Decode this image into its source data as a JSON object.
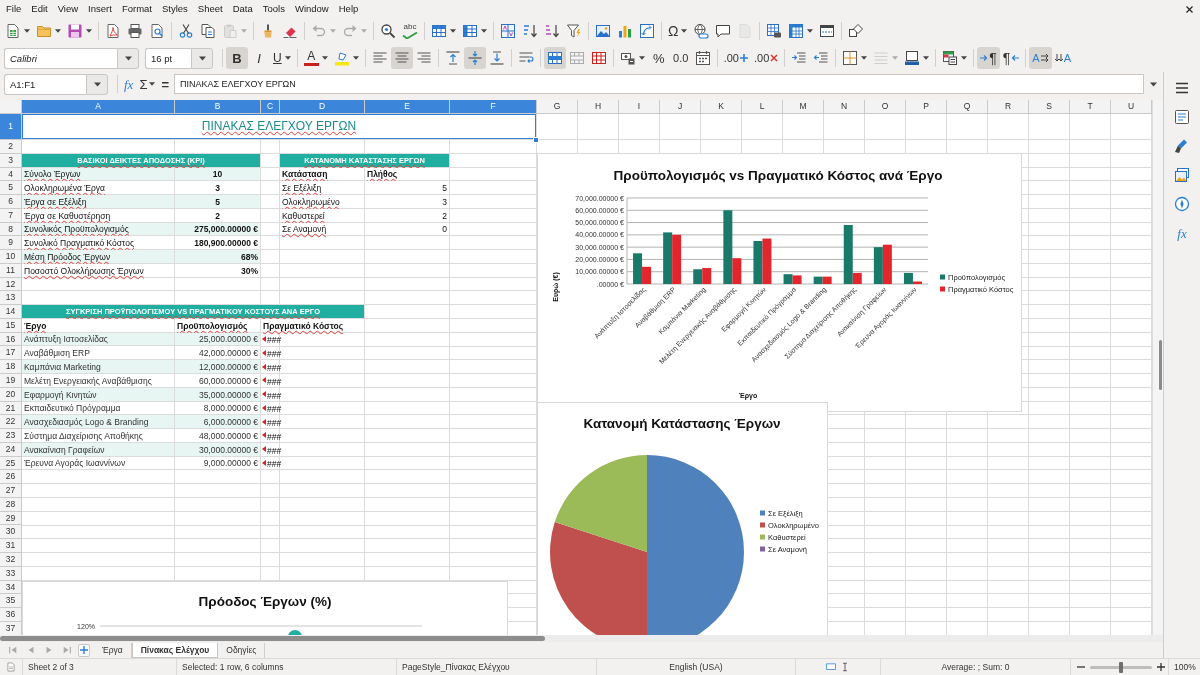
{
  "menu_bar": {
    "items": [
      "File",
      "Edit",
      "View",
      "Insert",
      "Format",
      "Styles",
      "Sheet",
      "Data",
      "Tools",
      "Window",
      "Help"
    ]
  },
  "standard_toolbar": {
    "groups": [
      [
        {
          "kind": "new",
          "dropdown": true,
          "disabled": false
        },
        {
          "kind": "open",
          "dropdown": true,
          "disabled": false
        },
        {
          "kind": "save",
          "dropdown": true,
          "disabled": false
        }
      ],
      [
        {
          "kind": "pdf",
          "dropdown": false,
          "disabled": false
        },
        {
          "kind": "print",
          "dropdown": false,
          "disabled": false
        },
        {
          "kind": "preview",
          "dropdown": false,
          "disabled": false
        }
      ],
      [
        {
          "kind": "cut",
          "dropdown": false,
          "disabled": false
        },
        {
          "kind": "copy",
          "dropdown": false,
          "disabled": false
        },
        {
          "kind": "paste",
          "dropdown": true,
          "disabled": true
        }
      ],
      [
        {
          "kind": "clone",
          "dropdown": false,
          "disabled": false
        },
        {
          "kind": "clear",
          "dropdown": false,
          "disabled": false
        }
      ],
      [
        {
          "kind": "undo",
          "dropdown": true,
          "disabled": true
        },
        {
          "kind": "redo",
          "dropdown": true,
          "disabled": true
        }
      ],
      [
        {
          "kind": "find",
          "dropdown": false,
          "disabled": false
        },
        {
          "kind": "spelling",
          "label": "abc",
          "dropdown": false,
          "disabled": false
        }
      ],
      [
        {
          "kind": "rows",
          "dropdown": true,
          "disabled": false
        },
        {
          "kind": "columns",
          "dropdown": true,
          "disabled": false
        }
      ],
      [
        {
          "kind": "sort",
          "dropdown": false,
          "disabled": false
        },
        {
          "kind": "sortasc",
          "dropdown": false,
          "disabled": false
        },
        {
          "kind": "sortdesc",
          "dropdown": false,
          "disabled": false
        },
        {
          "kind": "filter",
          "dropdown": false,
          "disabled": false
        }
      ],
      [
        {
          "kind": "image",
          "dropdown": false,
          "disabled": false
        },
        {
          "kind": "chart",
          "dropdown": false,
          "disabled": false
        },
        {
          "kind": "pivot",
          "dropdown": false,
          "disabled": false
        }
      ],
      [
        {
          "kind": "special",
          "label": "Ω",
          "dropdown": true,
          "disabled": false
        },
        {
          "kind": "link",
          "dropdown": false,
          "disabled": false
        },
        {
          "kind": "comment",
          "dropdown": false,
          "disabled": false
        },
        {
          "kind": "headerfooter",
          "dropdown": false,
          "disabled": true
        }
      ],
      [
        {
          "kind": "printarea",
          "dropdown": false,
          "disabled": false
        },
        {
          "kind": "freeze",
          "dropdown": true,
          "disabled": false
        },
        {
          "kind": "split",
          "dropdown": false,
          "disabled": false
        }
      ],
      [
        {
          "kind": "draw",
          "dropdown": false,
          "disabled": false
        }
      ]
    ]
  },
  "formatting_toolbar": {
    "font_name": "Calibri",
    "font_size": "16 pt",
    "groups": [
      [
        {
          "kind": "bold",
          "label": "B",
          "dropdown": false,
          "pressed": true,
          "disabled": false
        },
        {
          "kind": "italic",
          "label": "I",
          "dropdown": false,
          "pressed": false,
          "disabled": false
        },
        {
          "kind": "underline",
          "label": "U",
          "dropdown": true,
          "pressed": false,
          "disabled": false
        }
      ],
      [
        {
          "kind": "fontcolor",
          "label": "A",
          "dropdown": true,
          "pressed": false,
          "disabled": false
        },
        {
          "kind": "highlight",
          "dropdown": true,
          "pressed": false,
          "disabled": false
        }
      ],
      [
        {
          "kind": "left",
          "dropdown": false,
          "pressed": false,
          "disabled": false
        },
        {
          "kind": "center",
          "dropdown": false,
          "pressed": true,
          "disabled": false
        },
        {
          "kind": "right",
          "dropdown": false,
          "pressed": false,
          "disabled": false
        }
      ],
      [
        {
          "kind": "top",
          "dropdown": false,
          "pressed": false,
          "disabled": false
        },
        {
          "kind": "vcenter",
          "dropdown": false,
          "pressed": true,
          "disabled": false
        },
        {
          "kind": "bottom",
          "dropdown": false,
          "pressed": false,
          "disabled": false
        }
      ],
      [
        {
          "kind": "wrap",
          "dropdown": false,
          "pressed": false,
          "disabled": false
        }
      ],
      [
        {
          "kind": "mergecenter",
          "dropdown": false,
          "pressed": true,
          "disabled": false
        },
        {
          "kind": "merge",
          "dropdown": false,
          "pressed": false,
          "disabled": false
        },
        {
          "kind": "unmerge",
          "dropdown": false,
          "pressed": false,
          "disabled": false
        }
      ],
      [
        {
          "kind": "numformat",
          "dropdown": true,
          "pressed": false,
          "disabled": false
        },
        {
          "kind": "percent",
          "label": "%",
          "dropdown": false,
          "pressed": false,
          "disabled": false
        },
        {
          "kind": "decimal",
          "label": "0.0",
          "dropdown": false,
          "pressed": false,
          "disabled": false
        },
        {
          "kind": "date",
          "dropdown": false,
          "pressed": false,
          "disabled": false
        }
      ],
      [
        {
          "kind": "adddecimal",
          "label": ".00",
          "dropdown": false,
          "pressed": false,
          "disabled": false
        },
        {
          "kind": "deldecimal",
          "label": ".00",
          "dropdown": false,
          "pressed": false,
          "disabled": false
        }
      ],
      [
        {
          "kind": "indent",
          "dropdown": false,
          "pressed": false,
          "disabled": false
        },
        {
          "kind": "outdent",
          "dropdown": false,
          "pressed": false,
          "disabled": false
        }
      ],
      [
        {
          "kind": "borders",
          "dropdown": true,
          "pressed": false,
          "disabled": false
        },
        {
          "kind": "borderstyle",
          "dropdown": true,
          "pressed": false,
          "disabled": true
        },
        {
          "kind": "bordercolor",
          "dropdown": true,
          "pressed": false,
          "disabled": false
        }
      ],
      [
        {
          "kind": "conditional",
          "dropdown": true,
          "pressed": false,
          "disabled": false
        }
      ],
      [
        {
          "kind": "ltr",
          "label": "¶",
          "dropdown": false,
          "pressed": true,
          "disabled": false
        },
        {
          "kind": "rtl",
          "label": "¶",
          "dropdown": false,
          "pressed": false,
          "disabled": false
        }
      ],
      [
        {
          "kind": "textltr",
          "label": "A",
          "dropdown": false,
          "pressed": true,
          "disabled": false
        },
        {
          "kind": "texttb",
          "label": "A",
          "dropdown": false,
          "pressed": false,
          "disabled": false
        }
      ]
    ]
  },
  "formula_bar": {
    "name_box": "A1:F1",
    "wizard_label": "fx",
    "sum_label": "Σ",
    "equals_label": "=",
    "content": "ΠΙΝΑΚΑΣ ΕΛΕΓΧΟΥ ΕΡΓΩΝ"
  },
  "sidebar": {
    "tabs": [
      {
        "kind": "properties"
      },
      {
        "kind": "styles"
      },
      {
        "kind": "gallery"
      },
      {
        "kind": "navigator"
      },
      {
        "kind": "functions",
        "label": "fx"
      }
    ]
  },
  "sheet": {
    "columns": [
      {
        "label": "A",
        "selected": true
      },
      {
        "label": "B",
        "selected": true
      },
      {
        "label": "C",
        "selected": true
      },
      {
        "label": "D",
        "selected": true
      },
      {
        "label": "E",
        "selected": true
      },
      {
        "label": "F",
        "selected": true
      },
      {
        "label": "G",
        "selected": false
      },
      {
        "label": "H",
        "selected": false
      },
      {
        "label": "I",
        "selected": false
      },
      {
        "label": "J",
        "selected": false
      },
      {
        "label": "K",
        "selected": false
      },
      {
        "label": "L",
        "selected": false
      },
      {
        "label": "M",
        "selected": false
      },
      {
        "label": "N",
        "selected": false
      },
      {
        "label": "O",
        "selected": false
      },
      {
        "label": "P",
        "selected": false
      },
      {
        "label": "Q",
        "selected": false
      },
      {
        "label": "R",
        "selected": false
      },
      {
        "label": "S",
        "selected": false
      },
      {
        "label": "T",
        "selected": false
      },
      {
        "label": "U",
        "selected": false
      }
    ],
    "rows": [
      {
        "label": "1",
        "selected": true
      },
      {
        "label": "2",
        "selected": false
      },
      {
        "label": "3",
        "selected": false
      },
      {
        "label": "4",
        "selected": false
      },
      {
        "label": "5",
        "selected": false
      },
      {
        "label": "6",
        "selected": false
      },
      {
        "label": "7",
        "selected": false
      },
      {
        "label": "8",
        "selected": false
      },
      {
        "label": "9",
        "selected": false
      },
      {
        "label": "10",
        "selected": false
      },
      {
        "label": "11",
        "selected": false
      },
      {
        "label": "12",
        "selected": false
      },
      {
        "label": "13",
        "selected": false
      },
      {
        "label": "14",
        "selected": false
      },
      {
        "label": "15",
        "selected": false
      },
      {
        "label": "16",
        "selected": false
      },
      {
        "label": "17",
        "selected": false
      },
      {
        "label": "18",
        "selected": false
      },
      {
        "label": "19",
        "selected": false
      },
      {
        "label": "20",
        "selected": false
      },
      {
        "label": "21",
        "selected": false
      },
      {
        "label": "22",
        "selected": false
      },
      {
        "label": "23",
        "selected": false
      },
      {
        "label": "24",
        "selected": false
      },
      {
        "label": "25",
        "selected": false
      },
      {
        "label": "26",
        "selected": false
      },
      {
        "label": "27",
        "selected": false
      },
      {
        "label": "28",
        "selected": false
      },
      {
        "label": "29",
        "selected": false
      },
      {
        "label": "30",
        "selected": false
      },
      {
        "label": "31",
        "selected": false
      },
      {
        "label": "32",
        "selected": false
      },
      {
        "label": "33",
        "selected": false
      },
      {
        "label": "34",
        "selected": false
      },
      {
        "label": "35",
        "selected": false
      },
      {
        "label": "36",
        "selected": false
      },
      {
        "label": "37",
        "selected": false
      }
    ],
    "title": {
      "text": "ΠΙΝΑΚΑΣ ΕΛΕΓΧΟΥ ΕΡΓΩΝ",
      "selected": true
    },
    "kpi_table": {
      "heading": "ΒΑΣΙΚΟΙ ΔΕΙΚΤΕΣ ΑΠΟΔΟΣΗΣ (KPI)",
      "rows": [
        {
          "label": "Σύνολο Έργων",
          "value": "10",
          "kind": "count"
        },
        {
          "label": "Ολοκληρωμένα Έργα",
          "value": "3",
          "kind": "count"
        },
        {
          "label": "Έργα σε Εξέλιξη",
          "value": "5",
          "kind": "count"
        },
        {
          "label": "Έργα σε Καθυστέρηση",
          "value": "2",
          "kind": "count"
        },
        {
          "label": "Συνολικός Προϋπολογισμός",
          "value": "275,000.00000 €",
          "kind": "amount"
        },
        {
          "label": "Συνολικό Πραγματικό Κόστος",
          "value": "180,900.00000 €",
          "kind": "amount"
        },
        {
          "label": "Μέση Πρόοδος Έργων",
          "value": "68%",
          "kind": "percent"
        },
        {
          "label": "Ποσοστό Ολοκλήρωσης Έργων",
          "value": "30%",
          "kind": "percent"
        }
      ]
    },
    "status_table": {
      "heading": "ΚΑΤΑΝΟΜΗ ΚΑΤΑΣΤΑΣΗΣ ΕΡΓΩΝ",
      "columns": [
        "Κατάσταση",
        "Πλήθος"
      ],
      "rows": [
        {
          "status": "Σε Εξέλιξη",
          "count": "5"
        },
        {
          "status": "Ολοκληρωμένο",
          "count": "3"
        },
        {
          "status": "Καθυστερεί",
          "count": "2"
        },
        {
          "status": "Σε Αναμονή",
          "count": "0"
        }
      ]
    },
    "comparison_table": {
      "heading": "ΣΥΓΚΡΙΣΗ ΠΡΟΫΠΟΛΟΓΙΣΜΟΥ VS ΠΡΑΓΜΑΤΙΚΟΥ ΚΟΣΤΟΥΣ ΑΝΑ ΕΡΓΟ",
      "columns": [
        "Έργο",
        "Προϋπολογισμός",
        "Πραγματικό Κόστος"
      ],
      "rows": [
        {
          "project": "Ανάπτυξη Ιστοσελίδας",
          "budget": "25,000.00000 €",
          "actual": "###",
          "clipped": true
        },
        {
          "project": "Αναβάθμιση ERP",
          "budget": "42,000.00000 €",
          "actual": "###",
          "clipped": true
        },
        {
          "project": "Καμπάνια Marketing",
          "budget": "12,000.00000 €",
          "actual": "###",
          "clipped": true
        },
        {
          "project": "Μελέτη Ενεργειακής Αναβάθμισης",
          "budget": "60,000.00000 €",
          "actual": "###",
          "clipped": true
        },
        {
          "project": "Εφαρμογή Κινητών",
          "budget": "35,000.00000 €",
          "actual": "###",
          "clipped": true
        },
        {
          "project": "Εκπαιδευτικό Πρόγραμμα",
          "budget": "8,000.00000 €",
          "actual": "###",
          "clipped": true
        },
        {
          "project": "Ανασχεδιασμός Logo & Branding",
          "budget": "6,000.00000 €",
          "actual": "###",
          "clipped": true
        },
        {
          "project": "Σύστημα Διαχείρισης Αποθήκης",
          "budget": "48,000.00000 €",
          "actual": "###",
          "clipped": true
        },
        {
          "project": "Ανακαίνιση Γραφείων",
          "budget": "30,000.00000 €",
          "actual": "###",
          "clipped": true
        },
        {
          "project": "Έρευνα Αγοράς Ιωαννίνων",
          "budget": "9,000.00000 €",
          "actual": "###",
          "clipped": true
        }
      ]
    }
  },
  "charts": [
    {
      "chart_data": {
        "type": "bar",
        "title": "Προϋπολογισμός vs Πραγματικό Κόστος ανά Έργο",
        "xlabel": "Έργο",
        "ylabel": "Ευρώ (€)",
        "categories": [
          "Ανάπτυξη Ιστοσελίδας",
          "Αναβάθμιση ERP",
          "Καμπάνια Marketing",
          "Μελέτη Ενεργειακής Αναβάθμισης",
          "Εφαρμογή Κινητών",
          "Εκπαιδευτικό Πρόγραμμα",
          "Ανασχεδιασμός Logo & Branding",
          "Σύστημα Διαχείρισης Αποθήκης",
          "Ανακαίνιση Γραφείων",
          "Έρευνα Αγοράς Ιωαννίνων"
        ],
        "series": [
          {
            "name": "Προϋπολογισμός",
            "color": "#197a6a",
            "values": [
              25000,
              42000,
              12000,
              60000,
              35000,
              8000,
              6000,
              48000,
              30000,
              9000
            ]
          },
          {
            "name": "Πραγματικό Κόστος",
            "color": "#e3262d",
            "values": [
              14000,
              40000,
              13000,
              21000,
              37000,
              7000,
              6000,
              9000,
              32000,
              2000
            ]
          }
        ],
        "ylim": [
          0,
          70000
        ],
        "yticks": [
          {
            "value": 0,
            "label": ".00000 €"
          },
          {
            "value": 10000,
            "label": "10,000.00000 €"
          },
          {
            "value": 20000,
            "label": "20,000.00000 €"
          },
          {
            "value": 30000,
            "label": "30,000.00000 €"
          },
          {
            "value": 40000,
            "label": "40,000.00000 €"
          },
          {
            "value": 50000,
            "label": "50,000.00000 €"
          },
          {
            "value": 60000,
            "label": "60,000.00000 €"
          },
          {
            "value": 70000,
            "label": "70,000.00000 €"
          }
        ],
        "grid": true,
        "legend": "right"
      }
    },
    {
      "chart_data": {
        "type": "pie",
        "title": "Κατανομή Κατάστασης Έργων",
        "categories": [
          "Σε Εξέλιξη",
          "Ολοκληρωμένο",
          "Καθυστερεί",
          "Σε Αναμονή"
        ],
        "values": [
          50,
          30,
          20,
          0
        ],
        "legend": "right"
      },
      "slices": [
        {
          "color": "#4f81bd"
        },
        {
          "color": "#c0504d"
        },
        {
          "color": "#9bbb59"
        },
        {
          "color": "#8064a2"
        }
      ]
    }
  ],
  "progress_chart": {
    "title": "Πρόοδος Έργων (%)",
    "y_axis_labels": [
      "120%"
    ]
  },
  "sheet_tabs": {
    "navigation": [
      {
        "kind": "first",
        "disabled": true
      },
      {
        "kind": "previous",
        "disabled": true
      },
      {
        "kind": "next",
        "disabled": true
      },
      {
        "kind": "last",
        "disabled": true
      }
    ],
    "tabs": [
      {
        "label": "Έργα",
        "selected": false
      },
      {
        "label": "Πίνακας Ελέγχου",
        "selected": true
      },
      {
        "label": "Οδηγίες",
        "selected": false
      }
    ]
  },
  "status_bar": {
    "sheet": "Sheet 2 of 3",
    "selection": "Selected: 1 row, 6 columns",
    "page_style": "PageStyle_Πίνακας Ελέγχου",
    "language": "English (USA)",
    "summary": "Average: ; Sum: 0",
    "zoom_slider": {
      "level": 0.5
    },
    "zoom": "100%"
  }
}
